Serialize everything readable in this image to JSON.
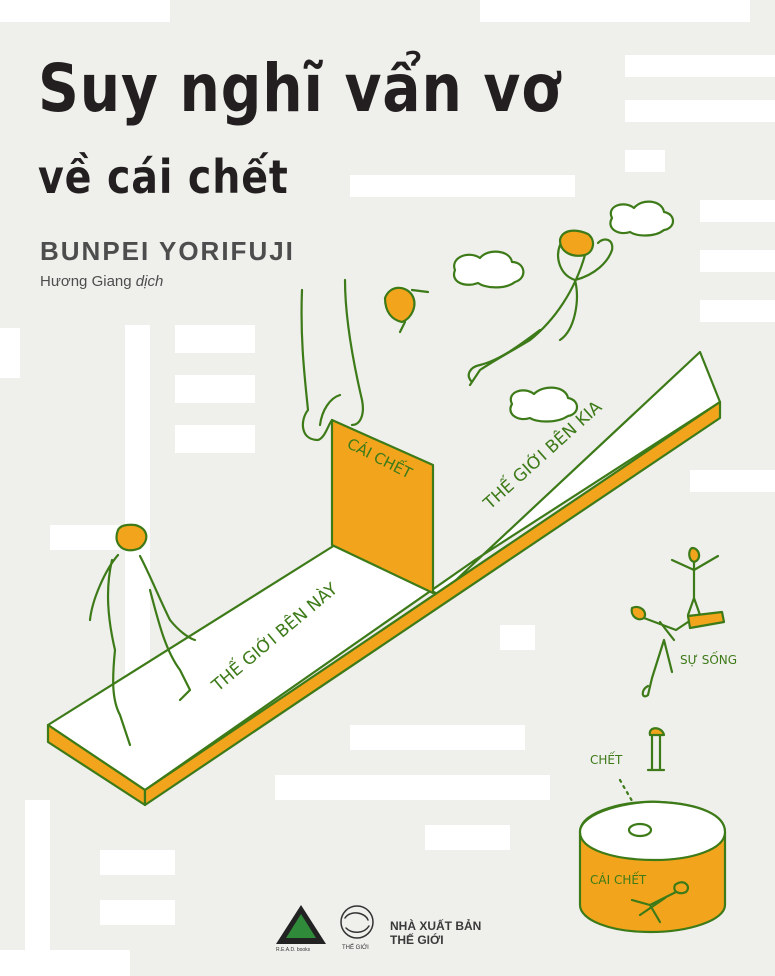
{
  "cover": {
    "title_line1": "Suy nghĩ vẩn vơ",
    "title_line2": "về cái chết",
    "author": "BUNPEI YORIFUJI",
    "translator_name": "Hương Giang",
    "translator_role": "dịch"
  },
  "illustration": {
    "label_death": "CÁI CHẾT",
    "label_this_world": "THẾ GIỚI BÊN NÀY",
    "label_other_world": "THẾ GIỚI BÊN KIA",
    "label_life": "SỰ SỐNG",
    "label_dead": "CHẾT",
    "label_death_small": "CÁI CHẾT"
  },
  "publishers": {
    "read_books_sub": "R.E.A.D. books",
    "thegioi_sub": "THẾ GIỚI",
    "publisher_line1": "NHÀ XUẤT BẢN",
    "publisher_line2": "THẾ GIỚI"
  },
  "colors": {
    "background": "#efefec",
    "orange": "#f2a51c",
    "line_green": "#3d7a18",
    "title": "#231f20"
  }
}
